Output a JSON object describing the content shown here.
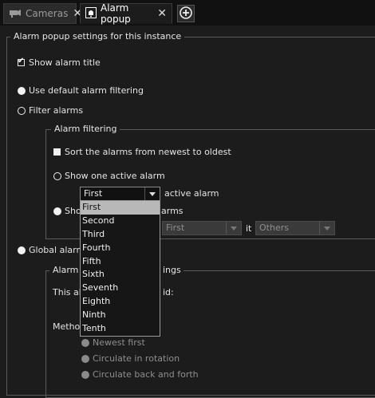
{
  "tabs": [
    {
      "label": "Cameras",
      "icon": "camera-icon",
      "active": false
    },
    {
      "label": "Alarm popup",
      "icon": "bell-icon",
      "active": true
    }
  ],
  "main": {
    "legend": "Alarm popup settings for this instance",
    "show_alarm_title": "Show alarm title",
    "use_default_filtering": "Use default alarm filtering",
    "filter_alarms": "Filter alarms",
    "filtering_group": {
      "legend": "Alarm filtering",
      "sort_newest": "Sort the alarms from newest to oldest",
      "show_one_active": "Show one active alarm",
      "active_alarm_select": "First",
      "active_alarm_suffix": "active alarm",
      "show_partial_prefix": "Sho",
      "show_partial_suffix": "arms",
      "range_from": "First",
      "range_mid": "it",
      "range_to": "Others"
    },
    "global_partial": "Global alarm",
    "global_group": {
      "legend_partial_left": "Alarm",
      "legend_partial_right": "ings",
      "id_partial_left": "This al",
      "id_partial_right": "id:",
      "method_partial": "Metho",
      "options": [
        "Newest first",
        "Circulate in rotation",
        "Circulate back and forth"
      ]
    }
  },
  "dropdown": {
    "options": [
      "First",
      "Second",
      "Third",
      "Fourth",
      "Fifth",
      "Sixth",
      "Seventh",
      "Eighth",
      "Ninth",
      "Tenth"
    ],
    "selected": "First"
  },
  "colors": {
    "background": "#1c1c1c",
    "selected_item": "#b8b8b8",
    "border": "#5a5a5a"
  }
}
